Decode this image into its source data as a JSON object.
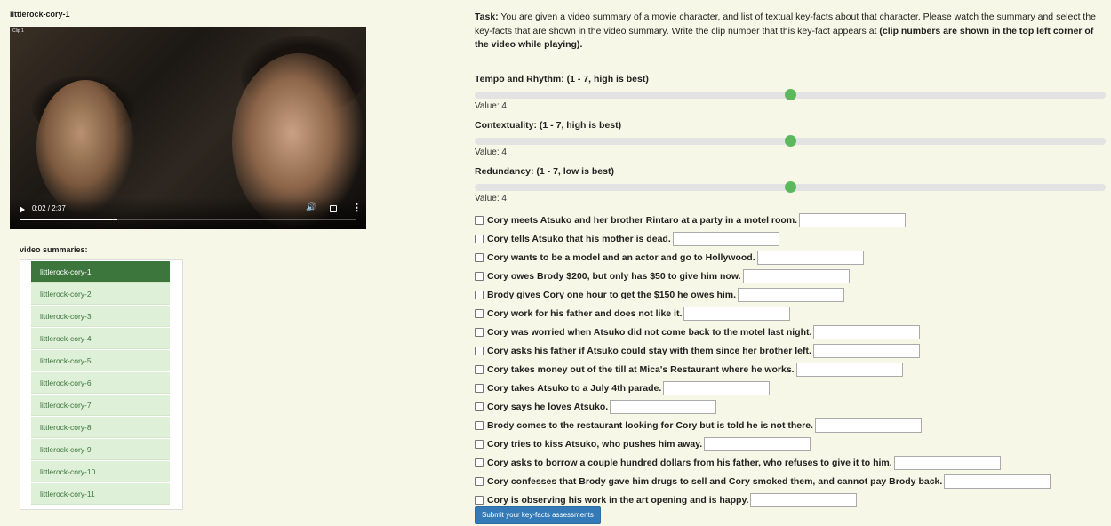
{
  "clip_title": "littlerock-cory-1",
  "video": {
    "clip_label": "Clip 1",
    "time": "0:02 / 2:37",
    "progress": 0.29,
    "play_icon": "play-icon",
    "volume_icon": "volume-icon",
    "fullscreen_icon": "fullscreen-icon",
    "more_icon": "more-options-icon"
  },
  "summaries": {
    "label": "video summaries:",
    "items": [
      "littlerock-cory-1",
      "littlerock-cory-2",
      "littlerock-cory-3",
      "littlerock-cory-4",
      "littlerock-cory-5",
      "littlerock-cory-6",
      "littlerock-cory-7",
      "littlerock-cory-8",
      "littlerock-cory-9",
      "littlerock-cory-10",
      "littlerock-cory-11"
    ],
    "active": "littlerock-cory-1"
  },
  "task": {
    "label": "Task:",
    "text": " You are given a video summary of a movie character, and list of textual key-facts about that character. Please watch the summary and select the key-facts that are shown in the video summary. Write the clip number that this key-fact appears at ",
    "bold_text": "(clip numbers are shown in the top left corner of the video while playing)",
    "end": "."
  },
  "ratings": [
    {
      "label": "Tempo and Rhythm: (1 - 7, high is best)",
      "value_text": "Value: 4",
      "value": 4,
      "min": 1,
      "max": 7
    },
    {
      "label": "Contextuality: (1 - 7, high is best)",
      "value_text": "Value: 4",
      "value": 4,
      "min": 1,
      "max": 7
    },
    {
      "label": "Redundancy: (1 - 7, low is best)",
      "value_text": "Value: 4",
      "value": 4,
      "min": 1,
      "max": 7
    }
  ],
  "facts": [
    "Cory meets Atsuko and her brother Rintaro at a party in a motel room.",
    "Cory tells Atsuko that his mother is dead.",
    "Cory wants to be a model and an actor and go to Hollywood.",
    "Cory owes Brody $200, but only has $50 to give him now.",
    "Brody gives Cory one hour to get the $150 he owes him.",
    "Cory work for his father and does not like it.",
    "Cory was worried when Atsuko did not come back to the motel last night.",
    "Cory asks his father if Atsuko could stay with them since her brother left.",
    "Cory takes money out of the till at Mica's Restaurant where he works.",
    "Cory takes Atsuko to a July 4th parade.",
    "Cory says he loves Atsuko.",
    "Brody comes to the restaurant looking for Cory but is told he is not there.",
    "Cory tries to kiss Atsuko, who pushes him away.",
    "Cory asks to borrow a couple hundred dollars from his father, who refuses to give it to him.",
    "Cory confesses that Brody gave him drugs to sell and Cory smoked them, and cannot pay Brody back.",
    "Cory is observing his work in the art opening and is happy."
  ],
  "submit_label": "Submit your key-facts assessments",
  "colors": {
    "accent_green": "#5cb85c",
    "active_item": "#3c763d",
    "submit": "#337ab7"
  }
}
